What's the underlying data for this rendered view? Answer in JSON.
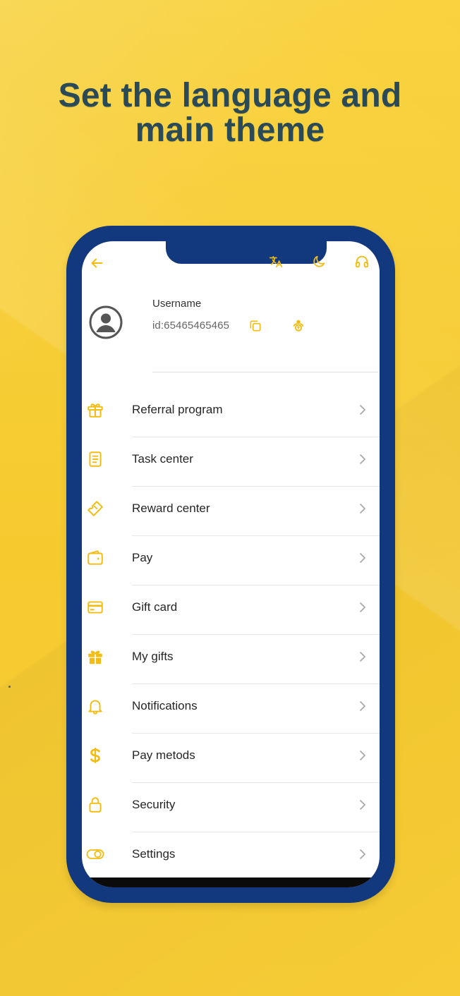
{
  "headline": "Set the language and\nmain theme",
  "colors": {
    "background": "#f7cf3a",
    "phone_frame": "#12387d",
    "accent": "#f2bc12",
    "headline": "#2a4a57"
  },
  "topbar": {
    "icons": [
      "arrow-left-icon",
      "translate-icon",
      "moon-icon",
      "headset-icon"
    ]
  },
  "profile": {
    "username": "Username",
    "id": "id:65465465465"
  },
  "menu": [
    {
      "label": "Referral program",
      "icon": "gift-outline-icon"
    },
    {
      "label": "Task center",
      "icon": "document-icon"
    },
    {
      "label": "Reward center",
      "icon": "ticket-icon"
    },
    {
      "label": "Pay",
      "icon": "wallet-icon"
    },
    {
      "label": "Gift card",
      "icon": "credit-card-icon"
    },
    {
      "label": "My gifts",
      "icon": "gift-filled-icon"
    },
    {
      "label": "Notifications",
      "icon": "bell-icon"
    },
    {
      "label": "Pay metods",
      "icon": "dollar-icon"
    },
    {
      "label": "Security",
      "icon": "lock-icon"
    },
    {
      "label": "Settings",
      "icon": "toggle-icon"
    }
  ]
}
